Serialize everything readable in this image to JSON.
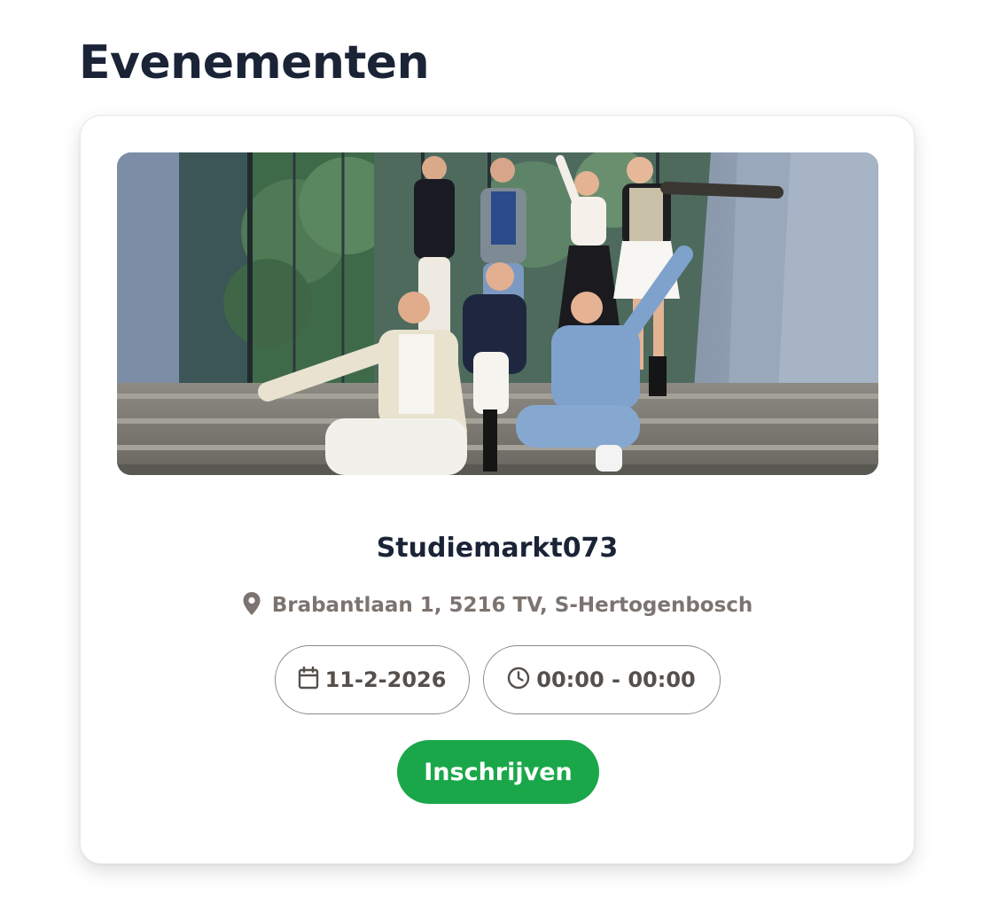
{
  "page": {
    "title": "Evenementen"
  },
  "event": {
    "name": "Studiemarkt073",
    "location": "Brabantlaan 1, 5216 TV, S-Hertogenbosch",
    "date": "11-2-2026",
    "time": "00:00 - 00:00",
    "signup_label": "Inschrijven",
    "image_icon": "group-photo"
  },
  "icons": {
    "location": "map-pin-icon",
    "date": "calendar-icon",
    "time": "clock-icon"
  },
  "colors": {
    "title": "#1b2437",
    "muted_text": "#7c7470",
    "pill_text": "#55504c",
    "button": "#1aa74a",
    "button_text": "#ffffff"
  }
}
